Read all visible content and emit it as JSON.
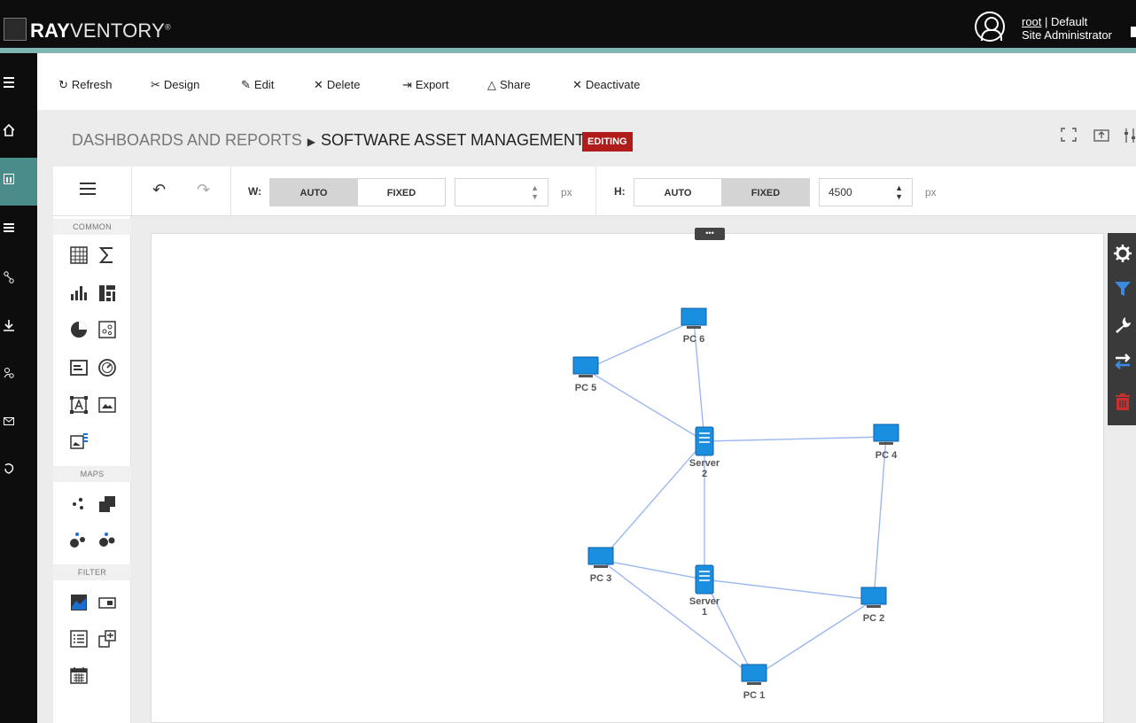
{
  "app": {
    "logo_text_bold": "RAY",
    "logo_text_light": "VENTORY",
    "logo_mark": "®"
  },
  "user": {
    "username": "root",
    "suffix": " | Default",
    "role": "Site Administrator"
  },
  "toolbar": {
    "refresh": "Refresh",
    "design": "Design",
    "edit": "Edit",
    "delete": "Delete",
    "export": "Export",
    "share": "Share",
    "deactivate": "Deactivate"
  },
  "breadcrumb": {
    "parent": "DASHBOARDS AND REPORTS",
    "current": "SOFTWARE ASSET MANAGEMENT",
    "badge": "EDITING"
  },
  "dimensions": {
    "w_label": "W:",
    "h_label": "H:",
    "auto": "AUTO",
    "fixed": "FIXED",
    "w_value": "",
    "h_value": "4500",
    "unit": "px",
    "w_mode": "AUTO",
    "h_mode": "FIXED"
  },
  "panel": {
    "common": "COMMON",
    "maps": "MAPS",
    "filter": "FILTER"
  },
  "graph": {
    "nodes": [
      {
        "id": "pc6",
        "label": "PC 6",
        "kind": "pc"
      },
      {
        "id": "pc5",
        "label": "PC 5",
        "kind": "pc"
      },
      {
        "id": "server2",
        "label": "Server",
        "label2": "2",
        "kind": "server"
      },
      {
        "id": "pc4",
        "label": "PC 4",
        "kind": "pc"
      },
      {
        "id": "pc3",
        "label": "PC 3",
        "kind": "pc"
      },
      {
        "id": "server1",
        "label": "Server",
        "label2": "1",
        "kind": "server"
      },
      {
        "id": "pc2",
        "label": "PC 2",
        "kind": "pc"
      },
      {
        "id": "pc1",
        "label": "PC 1",
        "kind": "pc"
      }
    ],
    "edges": [
      [
        "pc6",
        "pc5"
      ],
      [
        "pc6",
        "server2"
      ],
      [
        "pc5",
        "server2"
      ],
      [
        "server2",
        "pc4"
      ],
      [
        "server2",
        "pc3"
      ],
      [
        "server2",
        "server1"
      ],
      [
        "pc4",
        "pc2"
      ],
      [
        "pc3",
        "server1"
      ],
      [
        "pc3",
        "pc1"
      ],
      [
        "server1",
        "pc2"
      ],
      [
        "server1",
        "pc1"
      ],
      [
        "pc2",
        "pc1"
      ]
    ]
  },
  "colors": {
    "accent": "#7fb6b4",
    "nav_active": "#4a8c8a",
    "badge": "#b01b1b",
    "edge": "#9db8f0",
    "device": "#1a8fe0"
  }
}
